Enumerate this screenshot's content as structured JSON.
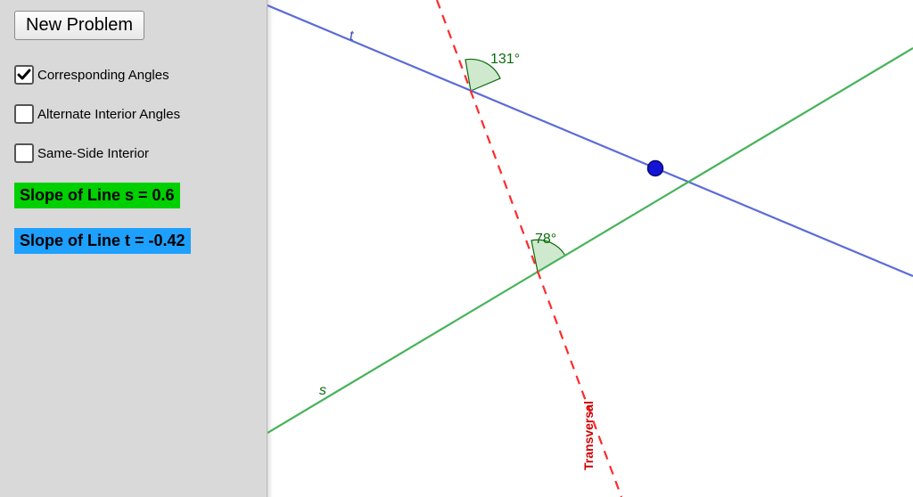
{
  "sidebar": {
    "new_problem_label": "New Problem",
    "checks": {
      "corresponding": {
        "label": "Corresponding Angles",
        "checked": true
      },
      "alternate_interior": {
        "label": "Alternate Interior Angles",
        "checked": false
      },
      "same_side_interior": {
        "label": "Same-Side Interior",
        "checked": false
      }
    },
    "slope_s_text": "Slope of Line s = 0.6",
    "slope_t_text": "Slope of Line t = -0.42"
  },
  "diagram": {
    "line_t_label": "t",
    "line_s_label": "s",
    "transversal_label": "Transversal",
    "angle_top": "131°",
    "angle_bottom": "78°",
    "colors": {
      "line_t": "#5b6bd8",
      "line_s": "#47b35a",
      "transversal": "#ff2a2a",
      "angle_fill": "#cfe9cf",
      "angle_stroke": "#0a6b0a",
      "point_fill": "#1414d6"
    }
  },
  "chart_data": {
    "type": "diagram",
    "description": "Two lines s and t crossed by a transversal, with corresponding angles marked.",
    "lines": [
      {
        "name": "t",
        "slope": -0.42,
        "color": "#5b6bd8"
      },
      {
        "name": "s",
        "slope": 0.6,
        "color": "#47b35a"
      },
      {
        "name": "Transversal",
        "style": "dashed",
        "color": "#ff2a2a"
      }
    ],
    "angles": [
      {
        "at_intersection": "transversal∩t",
        "value_deg": 131,
        "side": "upper-right"
      },
      {
        "at_intersection": "transversal∩s",
        "value_deg": 78,
        "side": "upper-right"
      }
    ],
    "point_on_line_t": true
  }
}
